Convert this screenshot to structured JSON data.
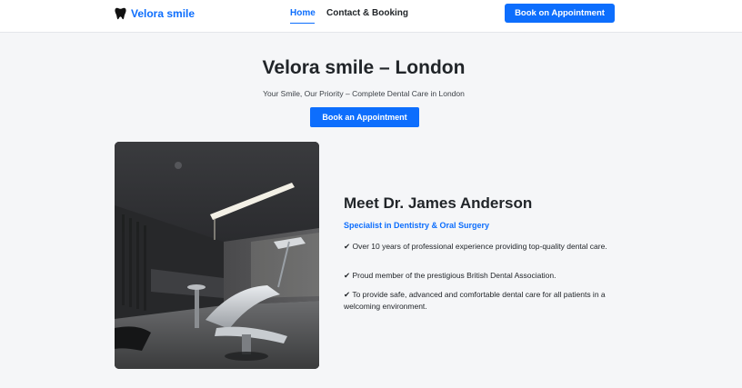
{
  "navbar": {
    "brand": "Velora smile",
    "links": [
      {
        "label": "Home",
        "active": true
      },
      {
        "label": "Contact & Booking",
        "active": false
      }
    ],
    "cta_label": "Book on Appointment"
  },
  "hero": {
    "title": "Velora smile – London",
    "subtitle": "Your Smile, Our Priority – Complete Dental Care in London",
    "cta_label": "Book an Appointment"
  },
  "doctor": {
    "name": "Meet Dr. James Anderson",
    "specialty": "Specialist in Dentistry & Oral Surgery",
    "points": [
      "✔ Over 10 years of professional experience providing top-quality dental care.",
      "✔ Proud member of the prestigious British Dental Association.",
      "✔ To provide safe, advanced and comfortable dental care for all patients in a welcoming environment."
    ]
  },
  "colors": {
    "primary": "#0d6efd",
    "background": "#f5f6f8",
    "text": "#212529"
  },
  "icons": {
    "brand": "tooth-icon",
    "bullet": "check-icon"
  }
}
